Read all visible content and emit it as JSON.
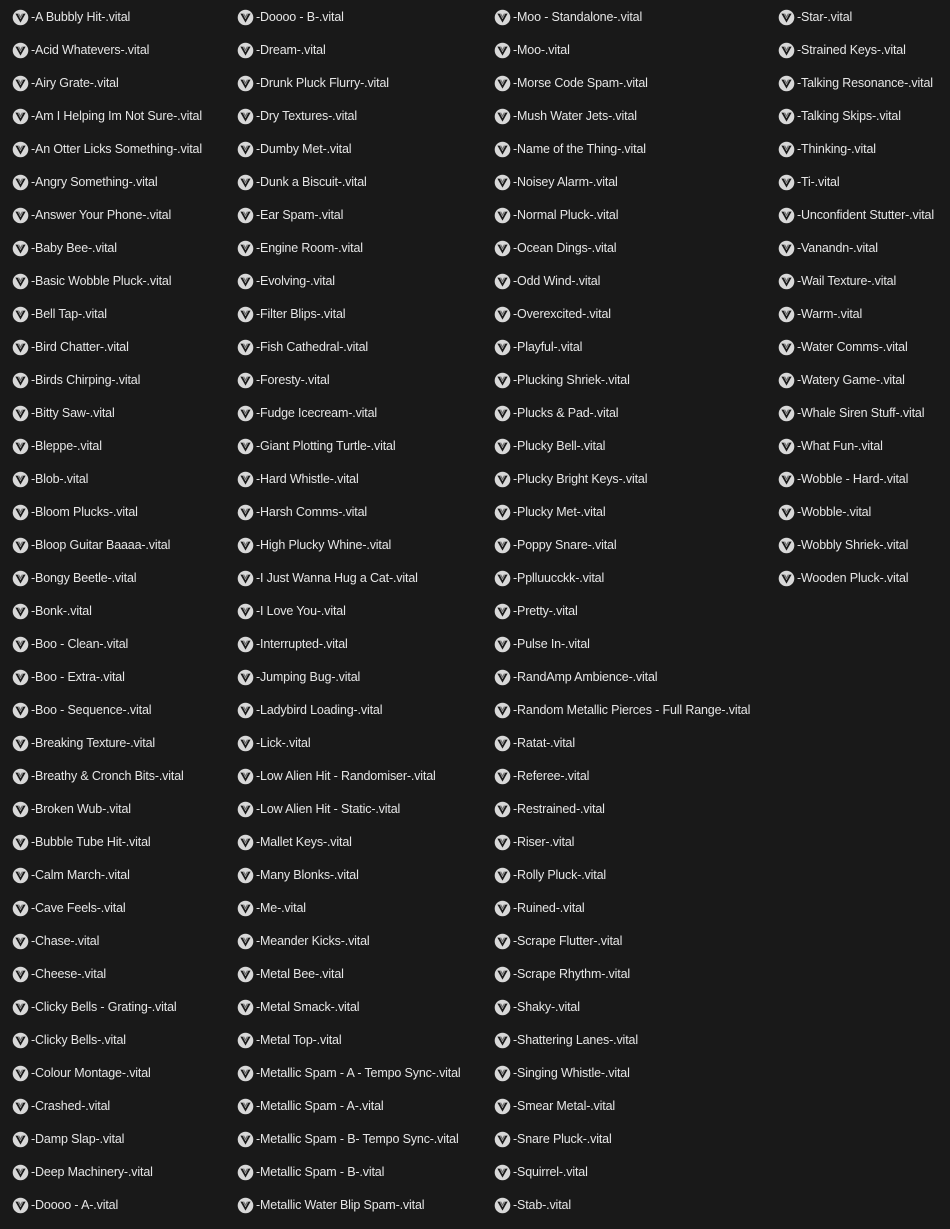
{
  "icon": "vital-preset-icon",
  "colors": {
    "background": "#191919",
    "text": "#e6e6e6",
    "icon_fill": "#d8d8d8"
  },
  "columns": [
    [
      "-A Bubbly Hit-.vital",
      "-Acid Whatevers-.vital",
      "-Airy Grate-.vital",
      "-Am I Helping Im Not Sure-.vital",
      "-An Otter Licks Something-.vital",
      "-Angry Something-.vital",
      "-Answer Your Phone-.vital",
      "-Baby Bee-.vital",
      "-Basic Wobble Pluck-.vital",
      "-Bell Tap-.vital",
      "-Bird Chatter-.vital",
      "-Birds Chirping-.vital",
      "-Bitty Saw-.vital",
      "-Bleppe-.vital",
      "-Blob-.vital",
      "-Bloom Plucks-.vital",
      "-Bloop Guitar Baaaa-.vital",
      "-Bongy Beetle-.vital",
      "-Bonk-.vital",
      "-Boo - Clean-.vital",
      "-Boo - Extra-.vital",
      "-Boo - Sequence-.vital",
      "-Breaking Texture-.vital",
      "-Breathy & Cronch Bits-.vital",
      "-Broken Wub-.vital",
      "-Bubble Tube Hit-.vital",
      "-Calm March-.vital",
      "-Cave Feels-.vital",
      "-Chase-.vital",
      "-Cheese-.vital",
      "-Clicky Bells - Grating-.vital",
      "-Clicky Bells-.vital",
      "-Colour Montage-.vital",
      "-Crashed-.vital",
      "-Damp Slap-.vital",
      "-Deep Machinery-.vital",
      "-Doooo - A-.vital"
    ],
    [
      "-Doooo - B-.vital",
      "-Dream-.vital",
      "-Drunk Pluck Flurry-.vital",
      "-Dry Textures-.vital",
      "-Dumby Met-.vital",
      "-Dunk a Biscuit-.vital",
      "-Ear Spam-.vital",
      "-Engine Room-.vital",
      "-Evolving-.vital",
      "-Filter Blips-.vital",
      "-Fish Cathedral-.vital",
      "-Foresty-.vital",
      "-Fudge Icecream-.vital",
      "-Giant Plotting Turtle-.vital",
      "-Hard Whistle-.vital",
      "-Harsh Comms-.vital",
      "-High Plucky Whine-.vital",
      "-I Just Wanna Hug a Cat-.vital",
      "-I Love You-.vital",
      "-Interrupted-.vital",
      "-Jumping Bug-.vital",
      "-Ladybird Loading-.vital",
      "-Lick-.vital",
      "-Low Alien Hit - Randomiser-.vital",
      "-Low Alien Hit - Static-.vital",
      "-Mallet Keys-.vital",
      "-Many Blonks-.vital",
      "-Me-.vital",
      "-Meander Kicks-.vital",
      "-Metal Bee-.vital",
      "-Metal Smack-.vital",
      "-Metal Top-.vital",
      "-Metallic Spam - A - Tempo Sync-.vital",
      "-Metallic Spam - A-.vital",
      "-Metallic Spam - B- Tempo Sync-.vital",
      "-Metallic Spam - B-.vital",
      "-Metallic Water Blip Spam-.vital"
    ],
    [
      "-Moo - Standalone-.vital",
      "-Moo-.vital",
      "-Morse Code Spam-.vital",
      "-Mush Water Jets-.vital",
      "-Name of the Thing-.vital",
      "-Noisey Alarm-.vital",
      "-Normal Pluck-.vital",
      "-Ocean Dings-.vital",
      "-Odd Wind-.vital",
      "-Overexcited-.vital",
      "-Playful-.vital",
      "-Plucking Shriek-.vital",
      "-Plucks & Pad-.vital",
      "-Plucky Bell-.vital",
      "-Plucky Bright Keys-.vital",
      "-Plucky Met-.vital",
      "-Poppy Snare-.vital",
      "-Pplluucckk-.vital",
      "-Pretty-.vital",
      "-Pulse In-.vital",
      "-RandAmp Ambience-.vital",
      "-Random Metallic Pierces - Full Range-.vital",
      "-Ratat-.vital",
      "-Referee-.vital",
      "-Restrained-.vital",
      "-Riser-.vital",
      "-Rolly Pluck-.vital",
      "-Ruined-.vital",
      "-Scrape Flutter-.vital",
      "-Scrape Rhythm-.vital",
      "-Shaky-.vital",
      "-Shattering Lanes-.vital",
      "-Singing Whistle-.vital",
      "-Smear Metal-.vital",
      "-Snare Pluck-.vital",
      "-Squirrel-.vital",
      "-Stab-.vital"
    ],
    [
      "-Star-.vital",
      "-Strained Keys-.vital",
      "-Talking Resonance-.vital",
      "-Talking Skips-.vital",
      "-Thinking-.vital",
      "-Ti-.vital",
      "-Unconfident Stutter-.vital",
      "-Vanandn-.vital",
      "-Wail Texture-.vital",
      "-Warm-.vital",
      "-Water Comms-.vital",
      "-Watery Game-.vital",
      "-Whale Siren Stuff-.vital",
      "-What Fun-.vital",
      "-Wobble - Hard-.vital",
      "-Wobble-.vital",
      "-Wobbly Shriek-.vital",
      "-Wooden Pluck-.vital"
    ]
  ]
}
